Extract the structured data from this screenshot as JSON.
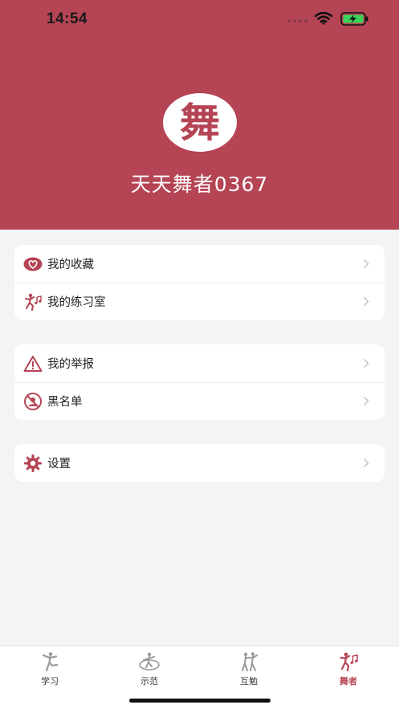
{
  "status_bar": {
    "time": "14:54",
    "signal_icon": "cellular-signal-icon",
    "wifi_icon": "wifi-icon",
    "battery_icon": "battery-charging-icon"
  },
  "profile": {
    "avatar_glyph": "舞",
    "username": "天天舞者0367",
    "background_color": "#b54455"
  },
  "menu_groups": [
    {
      "items": [
        {
          "label": "我的收藏",
          "icon": "heart-icon"
        },
        {
          "label": "我的练习室",
          "icon": "dancer-music-icon"
        }
      ]
    },
    {
      "items": [
        {
          "label": "我的举报",
          "icon": "warning-icon"
        },
        {
          "label": "黑名单",
          "icon": "blocked-user-icon"
        }
      ]
    },
    {
      "items": [
        {
          "label": "设置",
          "icon": "gear-icon"
        }
      ]
    }
  ],
  "tabs": [
    {
      "label": "学习",
      "icon": "ballet-dancer-icon",
      "active": false
    },
    {
      "label": "示范",
      "icon": "spinning-dancer-icon",
      "active": false
    },
    {
      "label": "互勉",
      "icon": "partner-dance-icon",
      "active": false
    },
    {
      "label": "舞者",
      "icon": "dancer-music-icon",
      "active": true
    }
  ],
  "colors": {
    "accent": "#b54455",
    "inactive_icon": "#9a9a9a",
    "background": "#f4f4f4"
  }
}
